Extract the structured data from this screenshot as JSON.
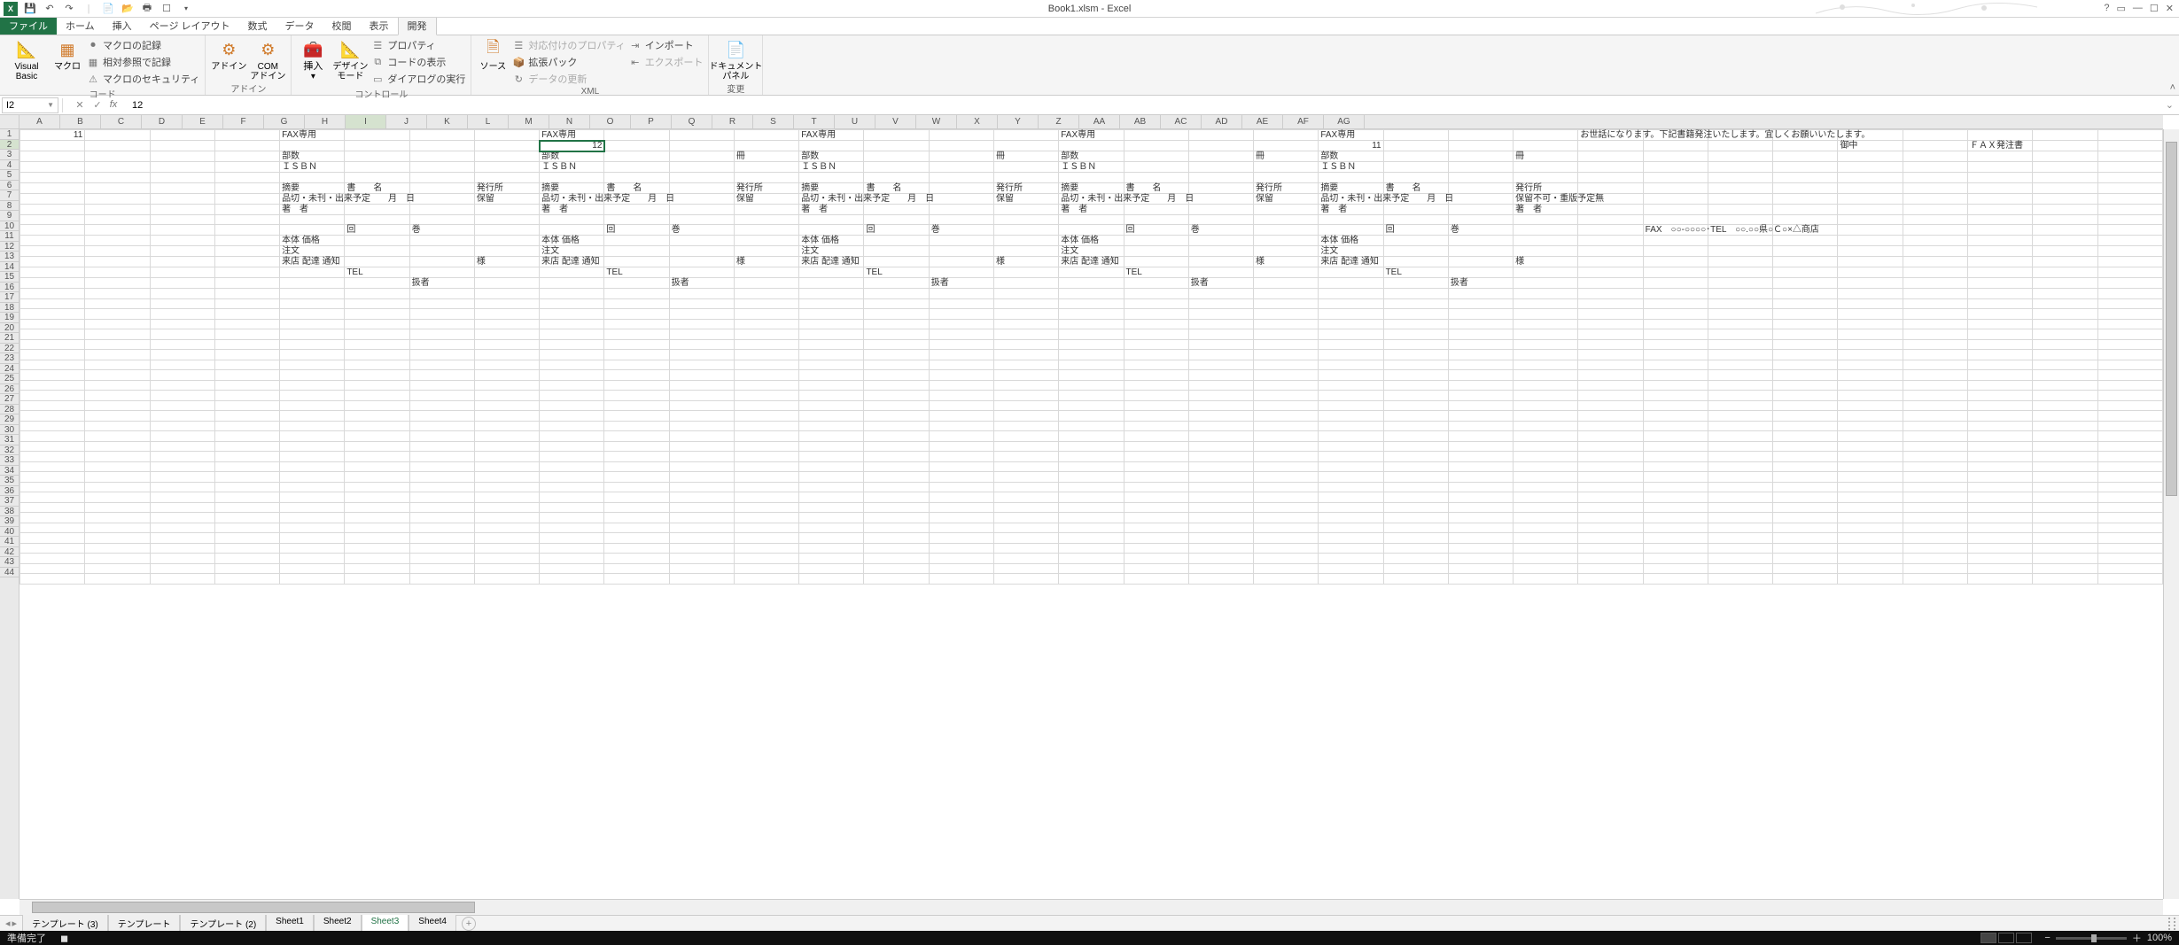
{
  "app": {
    "title": "Book1.xlsm - Excel"
  },
  "qat": {
    "excel_icon": "X",
    "save": "💾",
    "undo": "↶",
    "redo": "↷"
  },
  "ribbonTabs": {
    "file": "ファイル",
    "home": "ホーム",
    "insert": "挿入",
    "pagelayout": "ページ レイアウト",
    "formulas": "数式",
    "data": "データ",
    "review": "校閲",
    "view": "表示",
    "developer": "開発"
  },
  "ribbon": {
    "code": {
      "vb": "Visual Basic",
      "macro": "マクロ",
      "record": "マクロの記録",
      "relref": "相対参照で記録",
      "security": "マクロのセキュリティ",
      "group": "コード"
    },
    "addins": {
      "addin": "アドイン",
      "com": "COM\nアドイン",
      "group": "アドイン"
    },
    "controls": {
      "insert": "挿入",
      "design": "デザイン\nモード",
      "props": "プロパティ",
      "viewcode": "コードの表示",
      "dialog": "ダイアログの実行",
      "group": "コントロール"
    },
    "xml": {
      "source": "ソース",
      "mapprops": "対応付けのプロパティ",
      "expand": "拡張パック",
      "refresh": "データの更新",
      "import": "インポート",
      "export": "エクスポート",
      "group": "XML"
    },
    "modify": {
      "docpanel": "ドキュメント\nパネル",
      "group": "変更"
    }
  },
  "namebox": {
    "ref": "I2"
  },
  "formula": {
    "fx": "fx",
    "value": "12",
    "cancel": "✕",
    "enter": "✓"
  },
  "columns": [
    "A",
    "B",
    "C",
    "D",
    "E",
    "F",
    "G",
    "H",
    "I",
    "J",
    "K",
    "L",
    "M",
    "N",
    "O",
    "P",
    "Q",
    "R",
    "S",
    "T",
    "U",
    "V",
    "W",
    "X",
    "Y",
    "Z",
    "AA",
    "AB",
    "AC",
    "AD",
    "AE",
    "AF",
    "AG"
  ],
  "rows": [
    1,
    2,
    3,
    4,
    5,
    6,
    7,
    8,
    9,
    10,
    11,
    12,
    13,
    14,
    15,
    16,
    17,
    18,
    19,
    20,
    21,
    22,
    23,
    24,
    25,
    26,
    27,
    28,
    29,
    30,
    31,
    32,
    33,
    34,
    35,
    36,
    37,
    38,
    39,
    40,
    41,
    42,
    43,
    44
  ],
  "activeCell": {
    "col": "I",
    "row": 2
  },
  "cells": {
    "r1": {
      "A": "11",
      "E": "FAX専用",
      "I": "FAX専用",
      "M": "FAX専用",
      "Q": "FAX専用",
      "U": "FAX専用",
      "Y": "お世話になります。下記書籍発注いたします。宜しくお願いいたします。"
    },
    "r2": {
      "I": "12",
      "U": "11",
      "AC": "御中",
      "AE": "ＦＡＸ発注書"
    },
    "r3": {
      "E": "部数",
      "L": "冊",
      "I": "部数",
      "P": "冊",
      "M": "部数",
      "Q": "部数",
      "T": "冊",
      "U": "部数",
      "X": "冊"
    },
    "r4": {
      "E": "ＩＳＢＮ",
      "I": "ＩＳＢＮ",
      "M": "ＩＳＢＮ",
      "Q": "ＩＳＢＮ",
      "U": "ＩＳＢＮ"
    },
    "r6": {
      "E": "摘要",
      "F": "書　　名",
      "H": "発行所",
      "I": "摘要",
      "J": "書　　名",
      "L": "発行所",
      "M": "摘要",
      "N": "書　　名",
      "P": "発行所",
      "Q": "摘要",
      "R": "書　　名",
      "T": "発行所",
      "U": "摘要",
      "V": "書　　名",
      "X": "発行所"
    },
    "r7": {
      "E": "品切・未刊・出来予定　　月　日",
      "H2": "保留",
      "I": "品切・未刊・出来予定　　月　日",
      "L2": "保留",
      "M": "品切・未刊・出来予定　　月　日",
      "P2": "保留",
      "Q": "品切・未刊・出来予定　　月　日",
      "T2": "保留",
      "U": "品切・未刊・出来予定　　月　日",
      "X": "保留不可・重版予定無"
    },
    "r8": {
      "E": "著　者",
      "I": "著　者",
      "M": "著　者",
      "Q": "著　者",
      "U": "著　者",
      "X": "著　者"
    },
    "r10": {
      "F": "回",
      "G": "巻",
      "J": "回",
      "K": "巻",
      "N": "回",
      "O": "巻",
      "R": "回",
      "S": "巻",
      "V": "回",
      "W": "巻",
      "Z": "FAX　○○-○○○○･TEL　○○.○○県○Ｃ○×△商店"
    },
    "r11": {
      "E": "本体 価格",
      "I": "本体 価格",
      "M": "本体 価格",
      "Q": "本体 価格",
      "U": "本体 価格"
    },
    "r12": {
      "E": "注文",
      "I": "注文",
      "M": "注文",
      "Q": "注文",
      "U": "注文"
    },
    "r13": {
      "E": "来店 配達 通知",
      "H": "様",
      "I": "来店 配達 通知",
      "L": "様",
      "M": "来店 配達 通知",
      "P": "様",
      "Q": "来店 配達 通知",
      "T": "様",
      "U": "来店 配達 通知",
      "X": "様"
    },
    "r14": {
      "F": "TEL",
      "J": "TEL",
      "N": "TEL",
      "R": "TEL",
      "V": "TEL"
    },
    "r15": {
      "G": "扱者",
      "K": "扱者",
      "O": "扱者",
      "S": "扱者",
      "W": "扱者"
    }
  },
  "sheetTabs": {
    "nav": {
      "first": "◂",
      "prev": "◂",
      "next": "▸",
      "last": "▸"
    },
    "tabs": [
      "テンプレート (3)",
      "テンプレート",
      "テンプレート (2)",
      "Sheet1",
      "Sheet2",
      "Sheet3",
      "Sheet4"
    ],
    "active": "Sheet3",
    "add": "+"
  },
  "status": {
    "ready": "準備完了",
    "rec": "◼",
    "zoom": "100%",
    "minus": "−",
    "plus": "＋"
  }
}
